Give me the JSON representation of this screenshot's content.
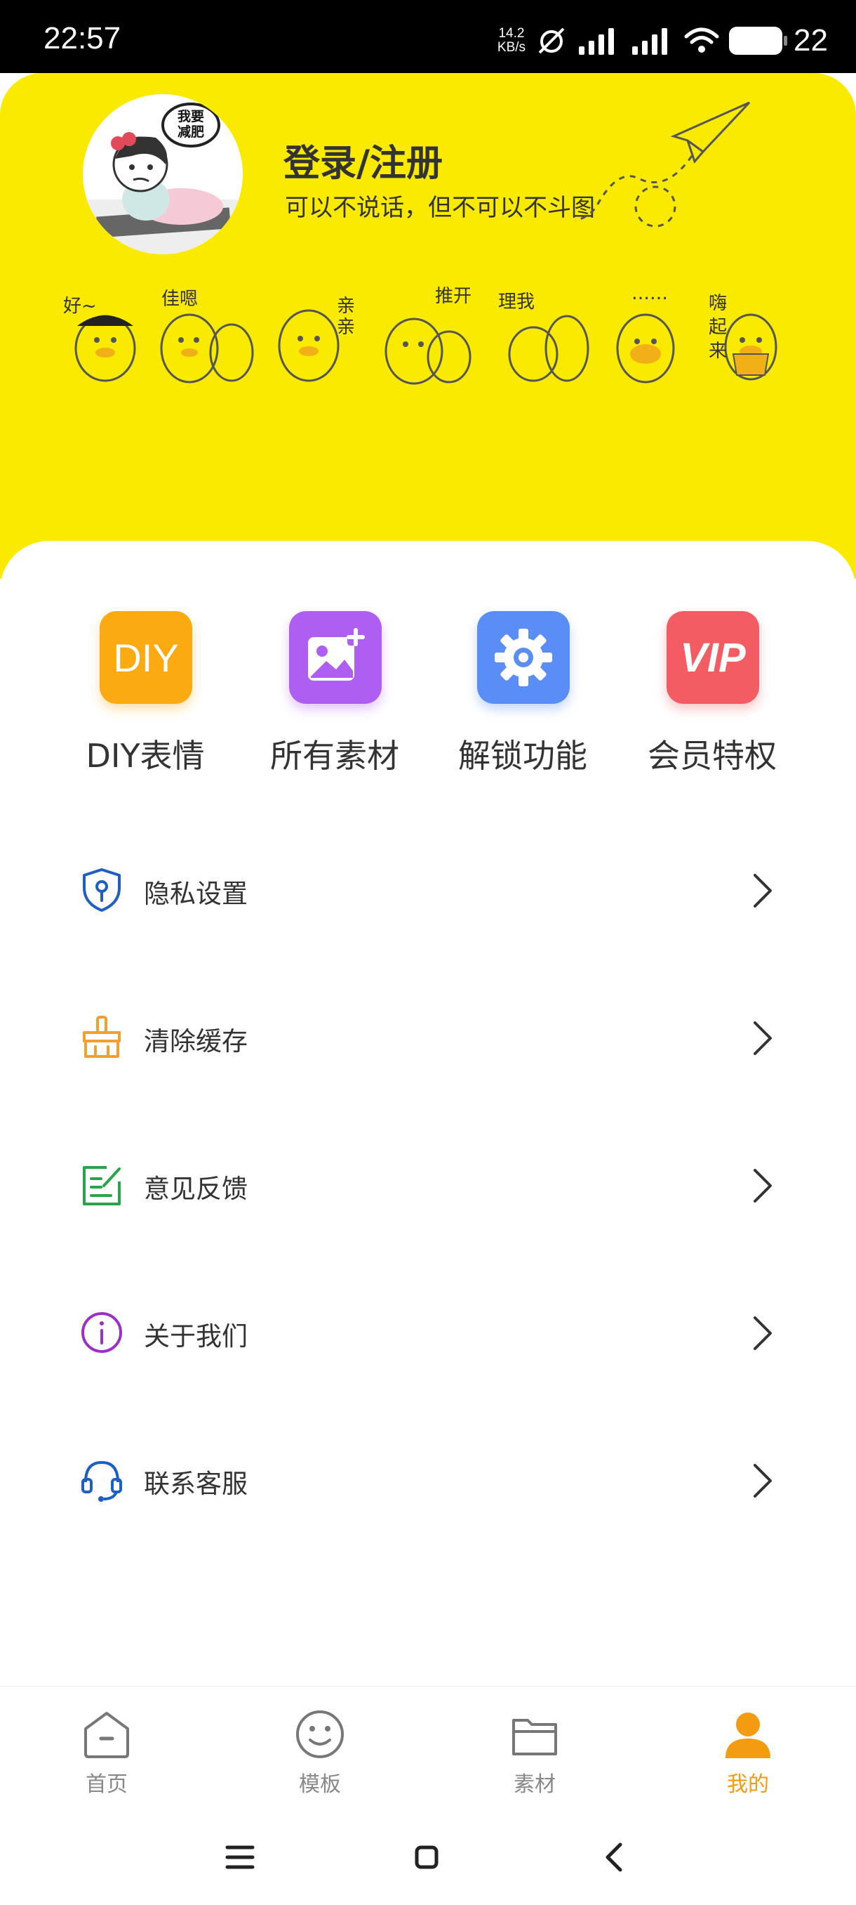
{
  "status_bar": {
    "time": "22:57",
    "net_speed_value": "14.2",
    "net_speed_unit": "KB/s",
    "battery_level": "22"
  },
  "header": {
    "login_title": "登录/注册",
    "login_subtitle": "可以不说话，但不可以不斗图",
    "avatar_bubble_text": "我要减肥",
    "background_color": "#f9ea00",
    "stickers": [
      "好~",
      "佳嗯",
      "亲亲",
      "推开",
      "理我",
      "……",
      "嗨起来"
    ]
  },
  "quick_actions": [
    {
      "label": "DIY表情",
      "icon": "diy-icon",
      "icon_text": "DIY",
      "color": "#fbaa12"
    },
    {
      "label": "所有素材",
      "icon": "image-add-icon",
      "color": "#ae5ef0"
    },
    {
      "label": "解锁功能",
      "icon": "gear-icon",
      "color": "#5a8df5"
    },
    {
      "label": "会员特权",
      "icon": "vip-icon",
      "icon_text": "VIP",
      "color": "#f35c63"
    }
  ],
  "menu": [
    {
      "label": "隐私设置",
      "icon": "shield-key-icon",
      "color": "#1e5fc2"
    },
    {
      "label": "清除缓存",
      "icon": "broom-icon",
      "color": "#f0a030"
    },
    {
      "label": "意见反馈",
      "icon": "edit-note-icon",
      "color": "#2aa44a"
    },
    {
      "label": "关于我们",
      "icon": "info-icon",
      "color": "#9b2fc8"
    },
    {
      "label": "联系客服",
      "icon": "headset-icon",
      "color": "#1e5fc2"
    }
  ],
  "tabs": [
    {
      "label": "首页",
      "icon": "home-icon",
      "active": false
    },
    {
      "label": "模板",
      "icon": "smile-icon",
      "active": false
    },
    {
      "label": "素材",
      "icon": "folder-icon",
      "active": false
    },
    {
      "label": "我的",
      "icon": "user-icon",
      "active": true
    }
  ],
  "accent_color": "#f39c12"
}
